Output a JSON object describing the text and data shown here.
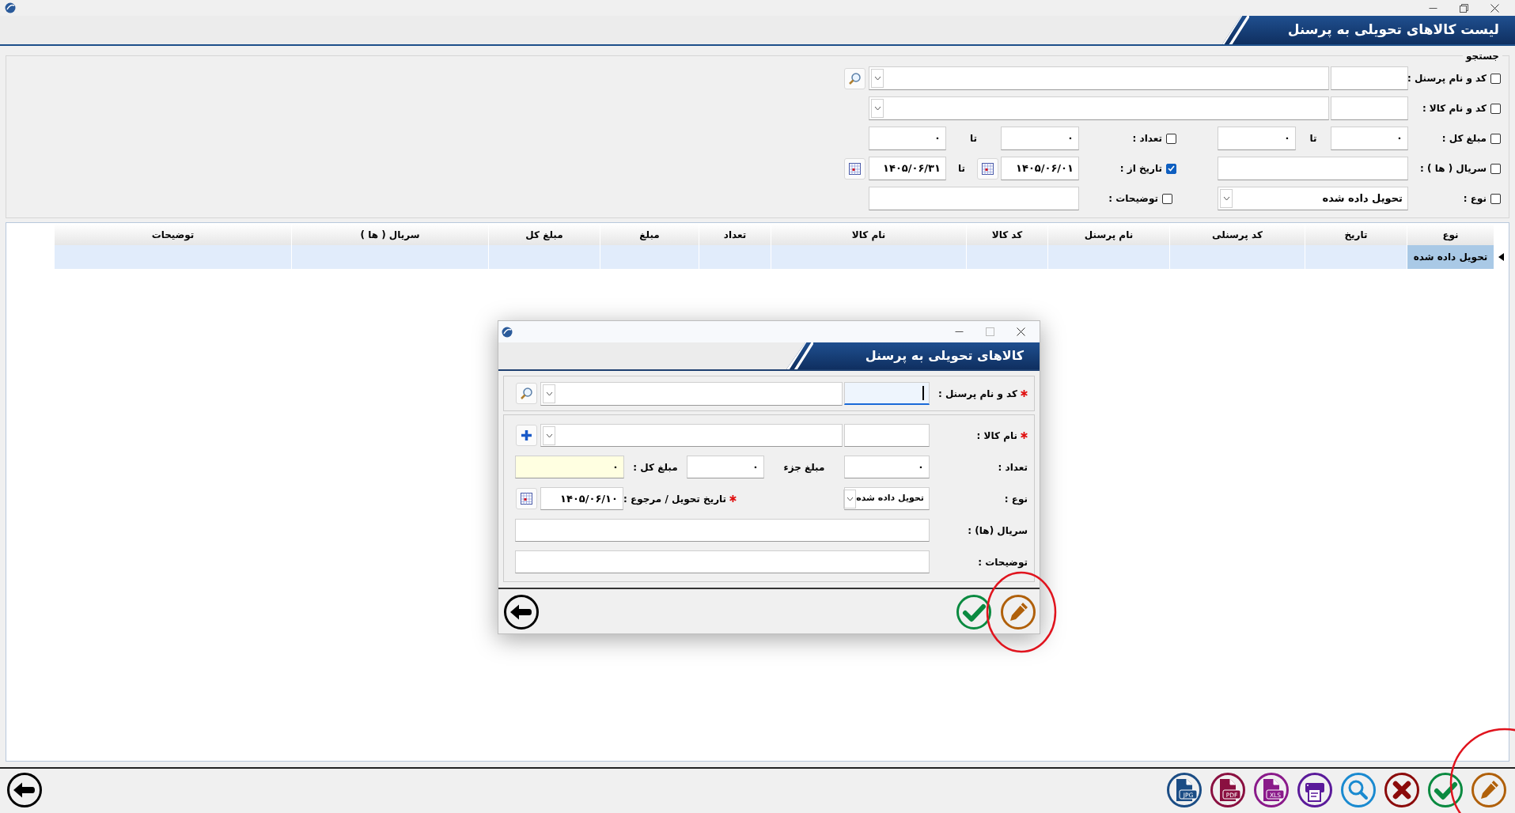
{
  "header": {
    "title": "لیست کالاهای تحویلی به پرسنل"
  },
  "search": {
    "legend": "جستجو",
    "personnel": {
      "label": "کد و نام پرسنل :",
      "checked": false
    },
    "item": {
      "label": "کد و نام کالا :",
      "checked": false
    },
    "total_amount": {
      "label": "مبلغ کل :",
      "checked": false,
      "from": "۰",
      "to_label": "تا",
      "to": "۰"
    },
    "count": {
      "label": "تعداد :",
      "checked": false,
      "from": "۰",
      "to_label": "تا",
      "to": "۰"
    },
    "serials": {
      "label": "سریال ( ها ) :",
      "checked": false
    },
    "date": {
      "label": "تاریخ از :",
      "checked": true,
      "from": "۱۴۰۵/۰۶/۰۱",
      "to_label": "تا",
      "to": "۱۴۰۵/۰۶/۳۱"
    },
    "type": {
      "label": "نوع :",
      "checked": false,
      "value": "تحویل داده شده"
    },
    "notes": {
      "label": "توضیحات :",
      "checked": false
    }
  },
  "table": {
    "columns": [
      "نوع",
      "تاریخ",
      "کد پرسنلی",
      "نام پرسنل",
      "کد کالا",
      "نام کالا",
      "تعداد",
      "مبلغ",
      "مبلغ کل",
      "سریال ( ها )",
      "توضیحات"
    ],
    "rows": [
      {
        "cells": [
          "تحویل داده شده"
        ],
        "selected": true
      }
    ]
  },
  "dialog": {
    "title": "کالاهای تحویلی به پرسنل",
    "personnel": {
      "label": "کد و نام پرسنل :",
      "required": true,
      "focused": true
    },
    "item": {
      "label": "نام کالا :",
      "required": true
    },
    "count": {
      "label": "تعداد :",
      "value": "۰"
    },
    "unit_price": {
      "label": "مبلغ جزء",
      "value": "۰"
    },
    "total": {
      "label": "مبلغ کل :",
      "value": "۰",
      "readonly": true
    },
    "type": {
      "label": "نوع :",
      "value": "تحویل داده شده"
    },
    "date": {
      "label": "تاریخ تحویل / مرجوع :",
      "required": true,
      "value": "۱۴۰۵/۰۶/۱۰"
    },
    "serials": {
      "label": "سریال (ها) :"
    },
    "notes": {
      "label": "توضیحات :"
    },
    "buttons": [
      {
        "kind": "edit",
        "color": "#b0600a"
      },
      {
        "kind": "confirm",
        "color": "#0a8a40"
      },
      {
        "kind": "back",
        "color": "#000000"
      }
    ]
  },
  "toolbar": [
    {
      "kind": "edit",
      "color": "#b0600a"
    },
    {
      "kind": "confirm",
      "color": "#0a8a40"
    },
    {
      "kind": "cancel",
      "color": "#8b0a0a"
    },
    {
      "kind": "search",
      "color": "#1a8ad0"
    },
    {
      "kind": "print",
      "color": "#5a1a9a"
    },
    {
      "kind": "file",
      "label": "XLS",
      "color": "#8a1a8a"
    },
    {
      "kind": "file",
      "label": "PDF",
      "color": "#8a1040"
    },
    {
      "kind": "file",
      "label": "JPG",
      "color": "#1b4d85"
    },
    {
      "kind": "back",
      "color": "#000000"
    }
  ]
}
